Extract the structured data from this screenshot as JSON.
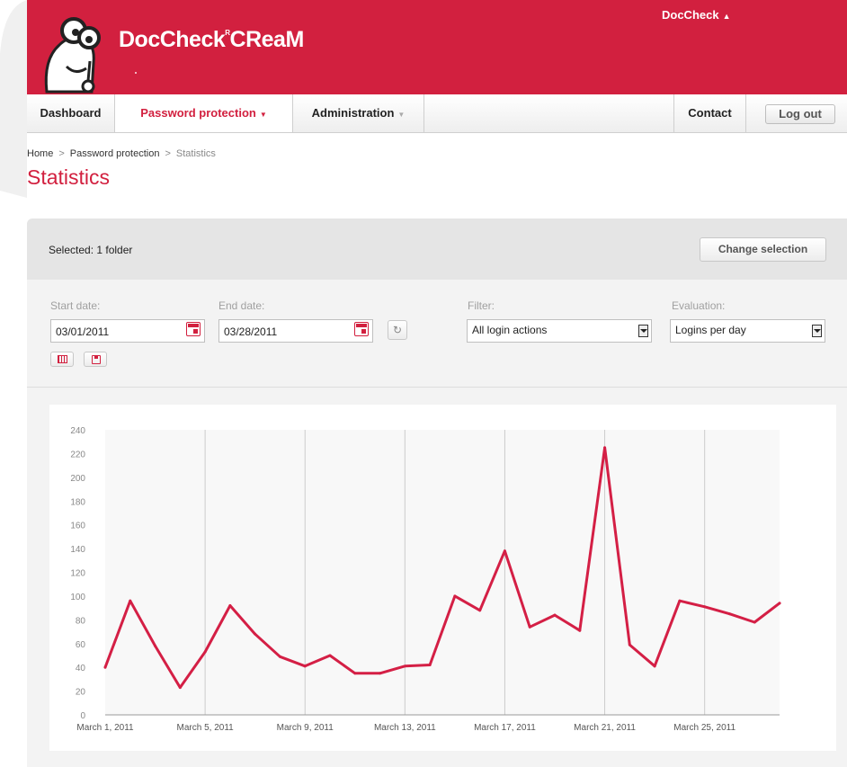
{
  "header": {
    "brand": "DocCheck",
    "brand_suffix": "CReaM",
    "registered_mark": "R",
    "user_menu": "DocCheck"
  },
  "nav": {
    "items": [
      {
        "label": "Dashboard"
      },
      {
        "label": "Password protection"
      },
      {
        "label": "Administration"
      }
    ],
    "contact": "Contact",
    "logout": "Log out"
  },
  "breadcrumb": {
    "home": "Home",
    "section": "Password protection",
    "current": "Statistics",
    "separator": ">"
  },
  "page": {
    "title": "Statistics"
  },
  "selection": {
    "label": "Selected: 1 folder",
    "change_button": "Change selection"
  },
  "filters": {
    "start_label": "Start date:",
    "start_value": "03/01/2011",
    "end_label": "End date:",
    "end_value": "03/28/2011",
    "refresh_glyph": "↻",
    "filter_label": "Filter:",
    "filter_value": "All login actions",
    "evaluation_label": "Evaluation:",
    "evaluation_value": "Logins per day"
  },
  "colors": {
    "accent": "#d2203f",
    "line": "#d41f45"
  },
  "chart_data": {
    "type": "line",
    "x": [
      "2011-03-01",
      "2011-03-02",
      "2011-03-03",
      "2011-03-04",
      "2011-03-05",
      "2011-03-06",
      "2011-03-07",
      "2011-03-08",
      "2011-03-09",
      "2011-03-10",
      "2011-03-11",
      "2011-03-12",
      "2011-03-13",
      "2011-03-14",
      "2011-03-15",
      "2011-03-16",
      "2011-03-17",
      "2011-03-18",
      "2011-03-19",
      "2011-03-20",
      "2011-03-21",
      "2011-03-22",
      "2011-03-23",
      "2011-03-24",
      "2011-03-25",
      "2011-03-26",
      "2011-03-27",
      "2011-03-28"
    ],
    "series": [
      {
        "values": [
          40,
          96,
          58,
          23,
          53,
          92,
          68,
          49,
          41,
          50,
          35,
          35,
          41,
          42,
          100,
          88,
          138,
          74,
          84,
          71,
          225,
          59,
          41,
          96,
          91,
          85,
          78,
          94
        ]
      }
    ],
    "ylim": [
      0,
      240
    ],
    "yticks": [
      0,
      20,
      40,
      60,
      80,
      100,
      120,
      140,
      160,
      180,
      200,
      220,
      240
    ],
    "xtick_labels": [
      "March 1, 2011",
      "March 5, 2011",
      "March 9, 2011",
      "March 13, 2011",
      "March 17, 2011",
      "March 21, 2011",
      "March 25, 2011"
    ],
    "xtick_indices": [
      0,
      4,
      8,
      12,
      16,
      20,
      24
    ],
    "grid": "vertical"
  }
}
